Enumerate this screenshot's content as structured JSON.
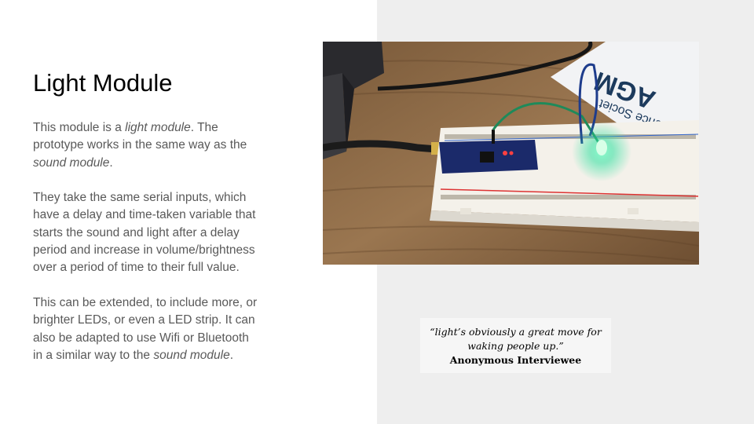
{
  "slide": {
    "title": "Light Module",
    "paragraph1": {
      "p1": "This module is a ",
      "em1": "light module",
      "p2": ". The prototype works in the same way as the ",
      "em2": "sound module",
      "p3": "."
    },
    "paragraph2": "They take the same serial inputs, which have a delay and time-taken variable that starts the sound and light after a delay period and increase in volume/brightness over a period of time to their full value.",
    "paragraph3": {
      "p1": "This can be extended, to include more, or brighter LEDs, or even a LED strip. It can also be adapted to use Wifi or Bluetooth in a similar way to the ",
      "em1": "sound module",
      "p2": "."
    },
    "photo": {
      "paper_text": "AGM",
      "paper_sub": "ience Societ"
    },
    "quote": {
      "text": "“light’s obviously a great move for waking people up.”",
      "author": "Anonymous Interviewee"
    }
  },
  "colors": {
    "body_text": "#595959",
    "right_panel": "#eeeeee",
    "quote_bg": "#f6f6f6"
  }
}
